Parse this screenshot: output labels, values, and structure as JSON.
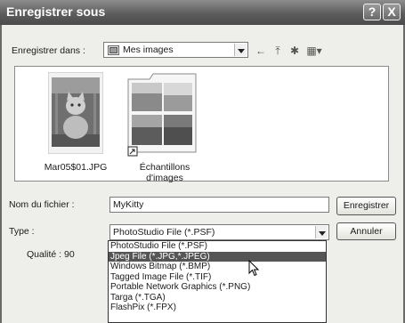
{
  "window": {
    "title": "Enregistrer sous",
    "help_glyph": "?",
    "close_glyph": "X"
  },
  "save_in": {
    "label": "Enregistrer dans :",
    "value": "Mes images",
    "back_glyph": "←",
    "up_glyph": "⤒",
    "newfolder_glyph": "✱",
    "views_glyph": "▦▾"
  },
  "files": [
    {
      "name": "Mar05$01.JPG",
      "icon": "photo-thumbnail"
    },
    {
      "name": "Échantillons d'images",
      "icon": "folder-thumbnail"
    }
  ],
  "filename": {
    "label": "Nom du fichier :",
    "value": "MyKitty"
  },
  "type": {
    "label": "Type :",
    "value": "PhotoStudio File (*.PSF)",
    "options": [
      "PhotoStudio File (*.PSF)",
      "Jpeg File (*.JPG,*.JPEG)",
      "Windows Bitmap (*.BMP)",
      "Tagged Image File (*.TIF)",
      "Portable Network Graphics (*.PNG)",
      "Targa (*.TGA)",
      "FlashPix (*.FPX)"
    ],
    "highlighted_index": 1
  },
  "quality": {
    "label": "Qualité : 90"
  },
  "buttons": {
    "save": "Enregistrer",
    "cancel": "Annuler"
  }
}
